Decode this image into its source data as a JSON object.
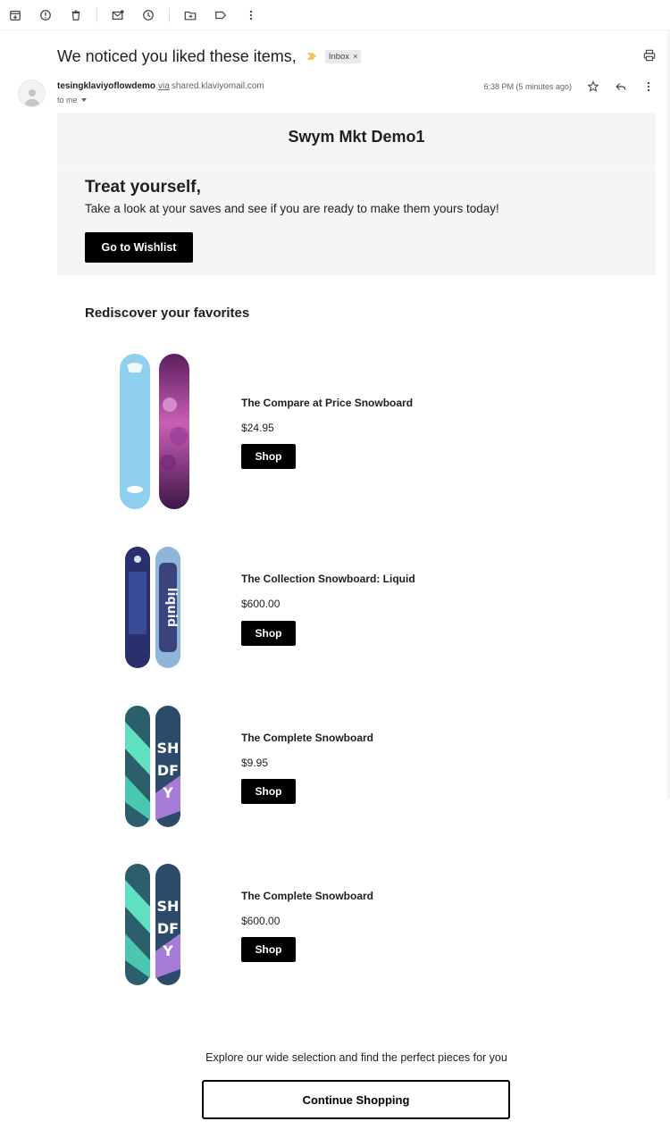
{
  "toolbar": {
    "icons": [
      "archive-icon",
      "report-spam-icon",
      "delete-icon",
      "mark-unread-icon",
      "snooze-icon",
      "move-to-icon",
      "label-icon",
      "more-icon"
    ]
  },
  "email": {
    "subject": "We noticed you liked these items,",
    "label": "Inbox",
    "sender_name": "tesingklaviyoflowdemo",
    "via": "via",
    "sender_domain": "shared.klaviyomail.com",
    "to": "to me",
    "time": "6:38 PM (5 minutes ago)"
  },
  "hero": {
    "brand": "Swym Mkt Demo1",
    "title": "Treat yourself,",
    "text": "Take a look at your saves and see if you are ready to make them yours today!",
    "button": "Go to Wishlist"
  },
  "favorites": {
    "title": "Rediscover your favorites",
    "products": [
      {
        "name": "The Compare at Price Snowboard",
        "price": "$24.95",
        "button": "Shop"
      },
      {
        "name": "The Collection Snowboard: Liquid",
        "price": "$600.00",
        "button": "Shop"
      },
      {
        "name": "The Complete Snowboard",
        "price": "$9.95",
        "button": "Shop"
      },
      {
        "name": "The Complete Snowboard",
        "price": "$600.00",
        "button": "Shop"
      }
    ]
  },
  "footer": {
    "text": "Explore our wide selection and find the perfect pieces for you",
    "button": "Continue Shopping"
  },
  "colors": {
    "hero_bg": "#f5f5f5",
    "button_bg": "#000000",
    "importance": "#f2c94c"
  }
}
